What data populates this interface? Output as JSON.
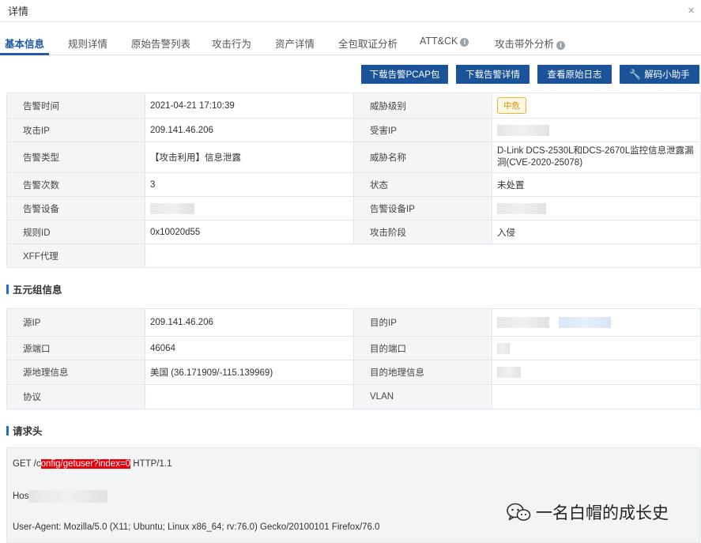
{
  "window": {
    "title": "详情",
    "close_symbol": "×"
  },
  "tabs": [
    {
      "label": "基本信息",
      "active": true
    },
    {
      "label": "规则详情"
    },
    {
      "label": "原始告警列表"
    },
    {
      "label": "攻击行为"
    },
    {
      "label": "资产详情"
    },
    {
      "label": "全包取证分析"
    },
    {
      "label": "ATT&CK",
      "info": true
    },
    {
      "label": "攻击带外分析",
      "info": true
    }
  ],
  "buttons": {
    "download_pcap": "下载告警PCAP包",
    "download_detail": "下载告警详情",
    "view_raw_log": "查看原始日志",
    "decode_helper": "解码小助手"
  },
  "basic": {
    "alert_time_label": "告警时间",
    "alert_time": "2021-04-21 17:10:39",
    "threat_level_label": "威胁级别",
    "threat_level": "中危",
    "attack_ip_label": "攻击IP",
    "attack_ip": "209.141.46.206",
    "victim_ip_label": "受害IP",
    "alert_type_label": "告警类型",
    "alert_type": "【攻击利用】信息泄露",
    "threat_name_label": "威胁名称",
    "threat_name": "D-Link DCS-2530L和DCS-2670L监控信息泄露漏洞(CVE-2020-25078)",
    "alert_count_label": "告警次数",
    "alert_count": "3",
    "status_label": "状态",
    "status": "未处置",
    "device_label": "告警设备",
    "device_ip_label": "告警设备IP",
    "rule_id_label": "规则ID",
    "rule_id": "0x10020d55",
    "attack_stage_label": "攻击阶段",
    "attack_stage": "入侵",
    "xff_label": "XFF代理"
  },
  "five_tuple": {
    "section_title": "五元组信息",
    "src_ip_label": "源IP",
    "src_ip": "209.141.46.206",
    "dst_ip_label": "目的IP",
    "src_port_label": "源端口",
    "src_port": "46064",
    "dst_port_label": "目的端口",
    "src_geo_label": "源地理信息",
    "src_geo": "美国 (36.171909/-115.139969)",
    "dst_geo_label": "目的地理信息",
    "protocol_label": "协议",
    "vlan_label": "VLAN"
  },
  "request_header": {
    "section_title": "请求头",
    "line1_prefix": "GET /c",
    "line1_highlight": "onfig/getuser?index=0",
    "line1_suffix": " HTTP/1.1",
    "host_prefix": "Hos",
    "user_agent": "User-Agent: Mozilla/5.0 (X11; Ubuntu; Linux x86_64; rv:76.0) Gecko/20100101 Firefox/76.0"
  },
  "watermark": {
    "text": "一名白帽的成长史"
  },
  "colors": {
    "primary": "#1b5399",
    "tab_active": "#1e5aa8",
    "section_bar": "#1e6fd0",
    "highlight": "#e8000b",
    "badge_mid": "#e08a00"
  }
}
